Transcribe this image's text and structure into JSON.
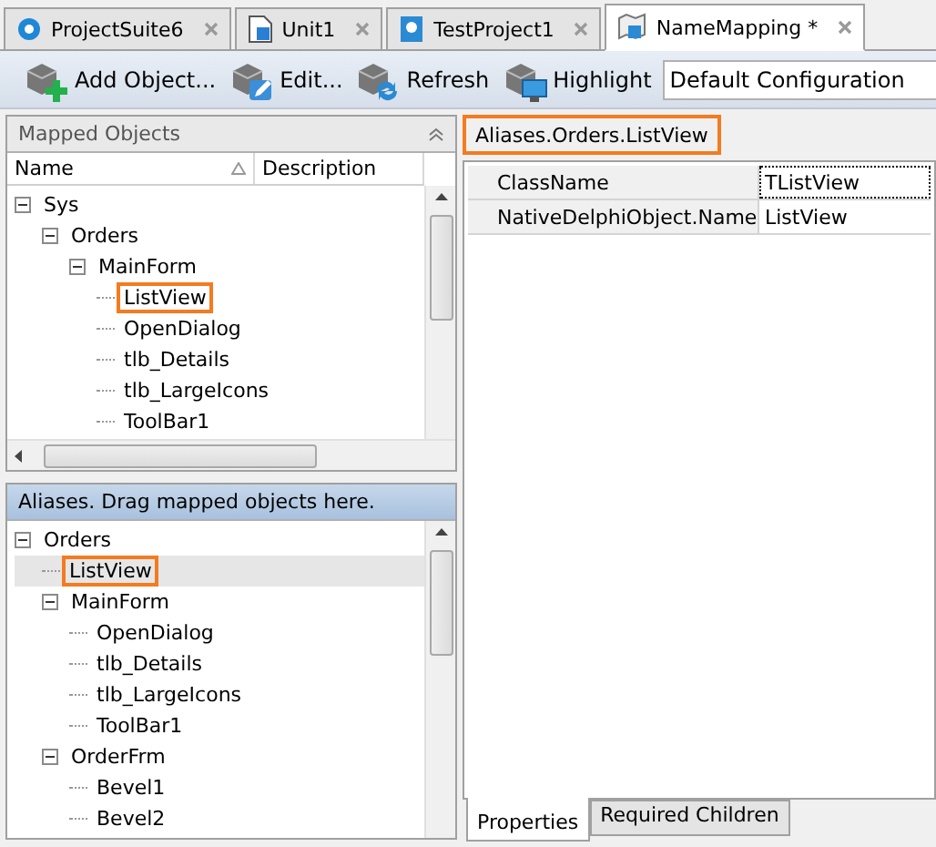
{
  "tabs": [
    {
      "label": "ProjectSuite6",
      "kind": "suite",
      "selected": false
    },
    {
      "label": "Unit1",
      "kind": "unit",
      "selected": false
    },
    {
      "label": "TestProject1",
      "kind": "project",
      "selected": false
    },
    {
      "label": "NameMapping *",
      "kind": "mapping",
      "selected": true
    }
  ],
  "toolbar": {
    "buttons": [
      {
        "label": "Add Object...",
        "kind": "add"
      },
      {
        "label": "Edit...",
        "kind": "edit"
      },
      {
        "label": "Refresh",
        "kind": "refresh"
      },
      {
        "label": "Highlight",
        "kind": "highlight"
      }
    ],
    "configuration": "Default Configuration"
  },
  "mapped_objects": {
    "title": "Mapped Objects",
    "columns": [
      "Name",
      "Description"
    ],
    "tree": [
      {
        "label": "Sys",
        "expanded": true,
        "highlighted": false,
        "children": [
          {
            "label": "Orders",
            "expanded": true,
            "highlighted": false,
            "children": [
              {
                "label": "MainForm",
                "expanded": true,
                "highlighted": false,
                "children": [
                  {
                    "label": "ListView",
                    "highlighted": true
                  },
                  {
                    "label": "OpenDialog",
                    "highlighted": false
                  },
                  {
                    "label": "tlb_Details",
                    "highlighted": false
                  },
                  {
                    "label": "tlb_LargeIcons",
                    "highlighted": false
                  },
                  {
                    "label": "ToolBar1",
                    "highlighted": false
                  }
                ]
              }
            ]
          }
        ]
      }
    ]
  },
  "aliases": {
    "title": "Aliases. Drag mapped objects here.",
    "tree": [
      {
        "label": "Orders",
        "expanded": true,
        "selected": false,
        "highlighted": false,
        "children": [
          {
            "label": "ListView",
            "selected": true,
            "highlighted": true
          },
          {
            "label": "MainForm",
            "expanded": true,
            "selected": false,
            "highlighted": false,
            "children": [
              {
                "label": "OpenDialog",
                "selected": false,
                "highlighted": false
              },
              {
                "label": "tlb_Details",
                "selected": false,
                "highlighted": false
              },
              {
                "label": "tlb_LargeIcons",
                "selected": false,
                "highlighted": false
              },
              {
                "label": "ToolBar1",
                "selected": false,
                "highlighted": false
              }
            ]
          },
          {
            "label": "OrderFrm",
            "expanded": true,
            "selected": false,
            "highlighted": false,
            "children": [
              {
                "label": "Bevel1",
                "selected": false,
                "highlighted": false
              },
              {
                "label": "Bevel2",
                "selected": false,
                "highlighted": false
              }
            ]
          }
        ]
      }
    ]
  },
  "details": {
    "path": "Aliases.Orders.ListView",
    "path_highlighted": true,
    "properties": [
      {
        "name": "ClassName",
        "value": "TListView",
        "focused": true
      },
      {
        "name": "NativeDelphiObject.Name",
        "value": "ListView",
        "focused": false
      }
    ],
    "tabs": [
      {
        "label": "Properties",
        "selected": true
      },
      {
        "label": "Required Children",
        "selected": false
      }
    ]
  }
}
